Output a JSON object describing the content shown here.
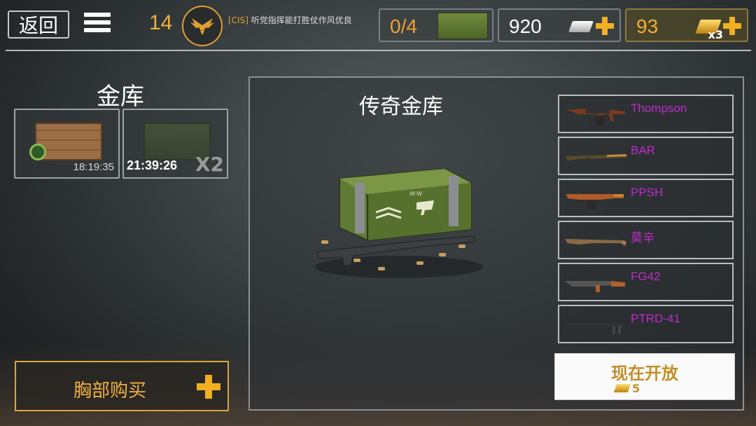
{
  "header": {
    "back_label": "返回",
    "rank_level": "14",
    "clan_tag": "[CIS]",
    "clan_motto": "听党指挥能打胜仗作风优良",
    "chests_count": "0/4",
    "silver_amount": "920",
    "gold_amount": "93",
    "gold_multiplier": "x3"
  },
  "vault": {
    "title": "金库",
    "slots": [
      {
        "timer": "18:19:35"
      },
      {
        "timer": "21:39:26",
        "multiplier": "X2"
      }
    ],
    "buy_chest_label": "胸部购买"
  },
  "legendary": {
    "title": "传奇金库",
    "weapons": [
      {
        "name": "Thompson"
      },
      {
        "name": "BAR"
      },
      {
        "name": "PPSH"
      },
      {
        "name": "莫辛"
      },
      {
        "name": "FG42"
      },
      {
        "name": "PTRD-41"
      }
    ],
    "weapon_name_color": "#c02acb",
    "open_label": "现在开放",
    "open_cost": "5"
  },
  "colors": {
    "accent_gold": "#f0b040",
    "crate_green": "#5f7a34"
  }
}
